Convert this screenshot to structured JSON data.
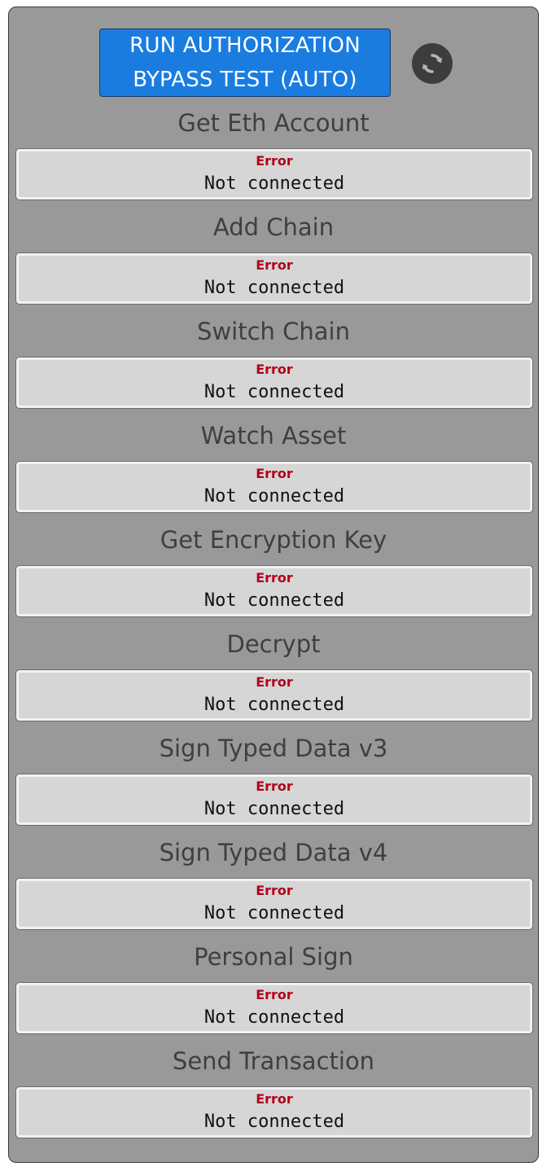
{
  "header": {
    "run_button_label": "RUN AUTHORIZATION BYPASS TEST (AUTO)",
    "refresh_icon": "refresh-icon"
  },
  "tests": [
    {
      "title": "Get Eth Account",
      "status": "Error",
      "message": "Not connected"
    },
    {
      "title": "Add Chain",
      "status": "Error",
      "message": "Not connected"
    },
    {
      "title": "Switch Chain",
      "status": "Error",
      "message": "Not connected"
    },
    {
      "title": "Watch Asset",
      "status": "Error",
      "message": "Not connected"
    },
    {
      "title": "Get Encryption Key",
      "status": "Error",
      "message": "Not connected"
    },
    {
      "title": "Decrypt",
      "status": "Error",
      "message": "Not connected"
    },
    {
      "title": "Sign Typed Data v3",
      "status": "Error",
      "message": "Not connected"
    },
    {
      "title": "Sign Typed Data v4",
      "status": "Error",
      "message": "Not connected"
    },
    {
      "title": "Personal Sign",
      "status": "Error",
      "message": "Not connected"
    },
    {
      "title": "Send Transaction",
      "status": "Error",
      "message": "Not connected"
    }
  ],
  "colors": {
    "panel_background": "#999999",
    "button_background": "#1b7ce0",
    "error_text": "#b3001b",
    "result_background": "#d6d6d6"
  }
}
